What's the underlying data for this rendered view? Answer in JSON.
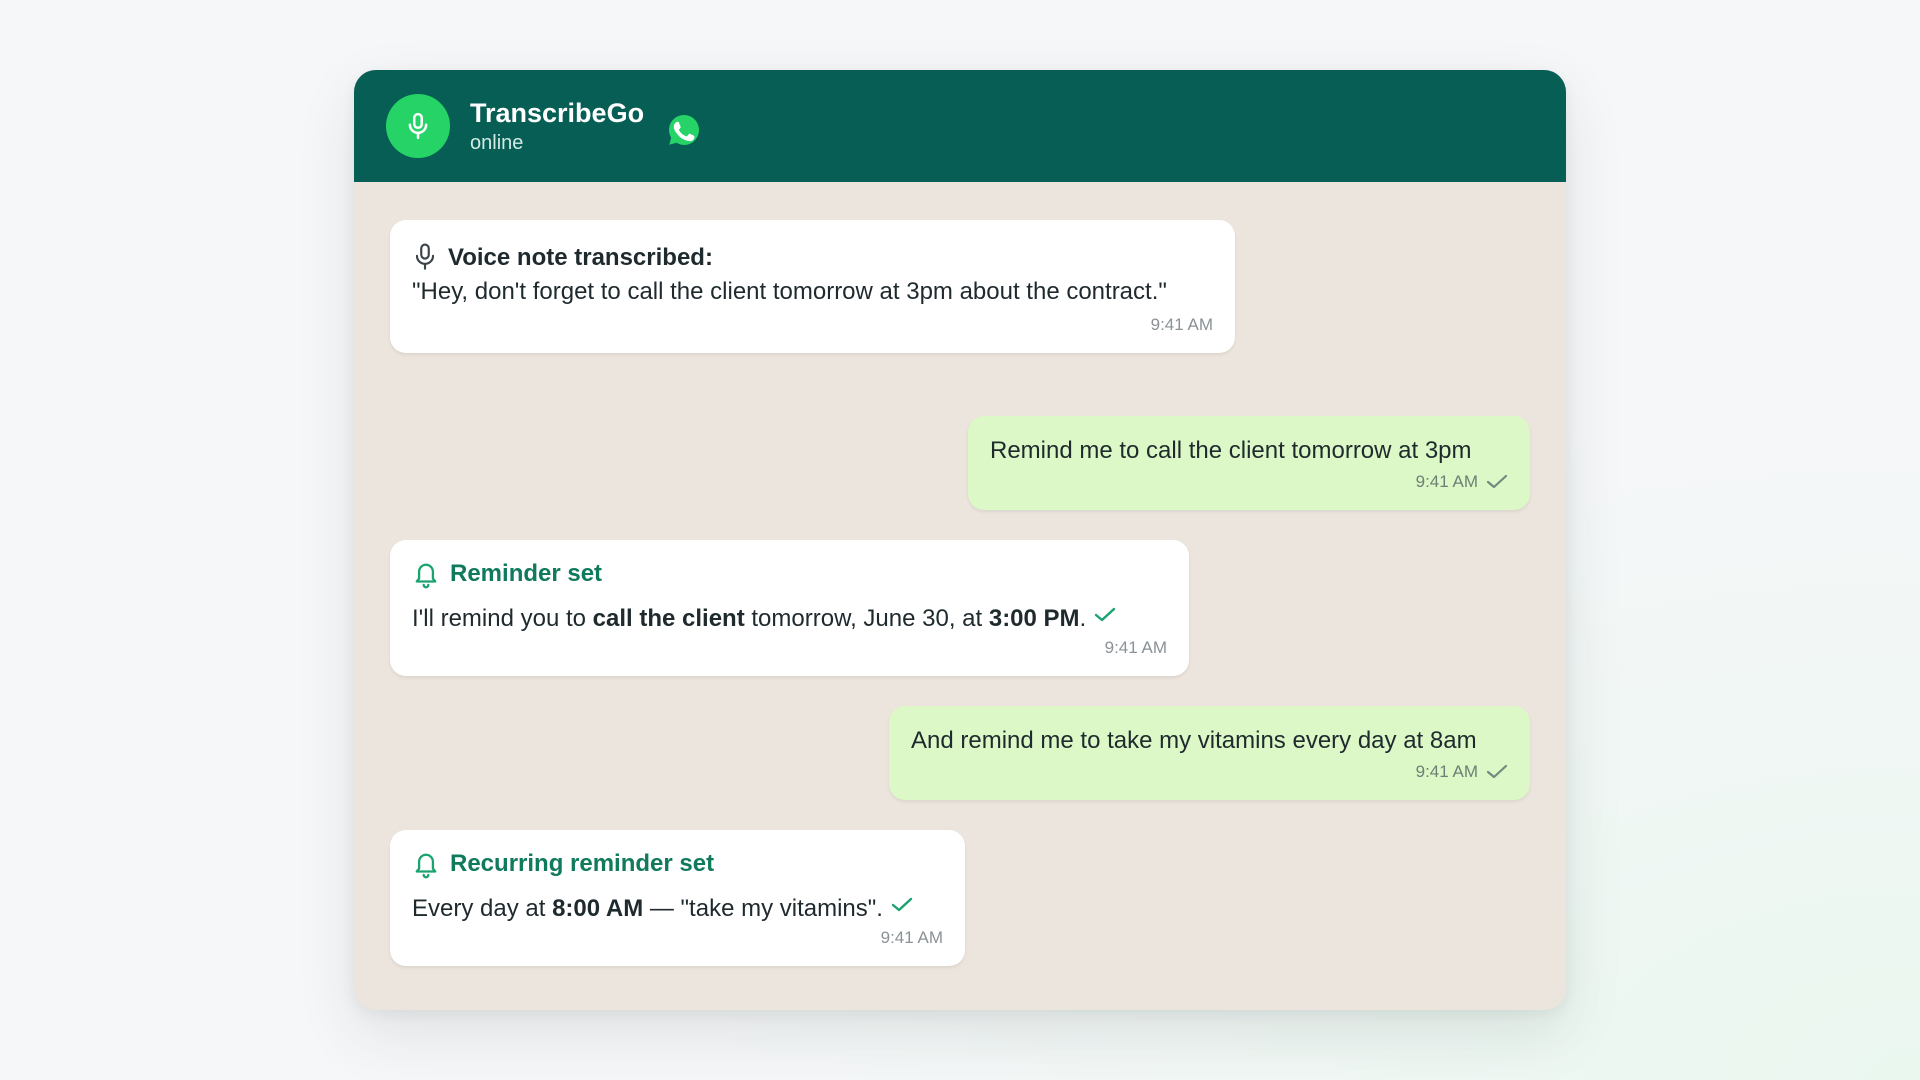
{
  "header": {
    "title": "TranscribeGo",
    "status": "online",
    "colors": {
      "header_bg": "#075e54",
      "avatar_bg": "#25d366",
      "accent": "#0f7a5c"
    },
    "icons": [
      "microphone-icon",
      "whatsapp-icon"
    ]
  },
  "messages": [
    {
      "type": "incoming",
      "title": "Voice note transcribed:",
      "icon": "microphone-icon",
      "text": "\"Hey, don't forget to call the client tomorrow at 3pm about the contract.\"",
      "time": "9:41 AM"
    },
    {
      "type": "outgoing",
      "text": "Remind me to call the client tomorrow at 3pm",
      "time": "9:41 AM",
      "status_icon": "check-icon"
    },
    {
      "type": "incoming",
      "title": "Reminder set",
      "icon": "bell-icon",
      "text_parts": [
        "I'll remind you to ",
        "call the client",
        " tomorrow, June 30, at ",
        "3:00 PM",
        "."
      ],
      "time": "9:41 AM",
      "status_icon": "check-icon"
    },
    {
      "type": "outgoing",
      "text": "And remind me to take my vitamins every day at 8am",
      "time": "9:41 AM",
      "status_icon": "check-icon"
    },
    {
      "type": "incoming",
      "title": "Recurring reminder set",
      "icon": "bell-icon",
      "text_parts": [
        "Every day at ",
        "8:00 AM",
        " — \"take my vitamins\"."
      ],
      "time": "9:41 AM",
      "status_icon": "check-icon"
    }
  ]
}
